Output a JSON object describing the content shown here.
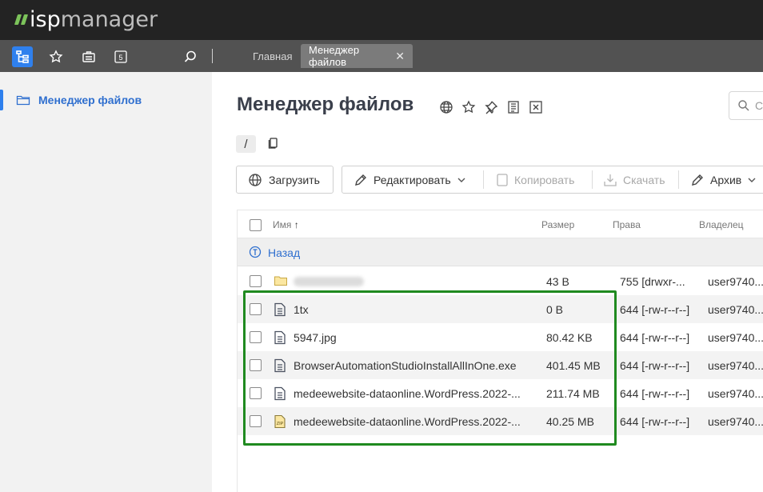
{
  "app": {
    "logo_prefix": "isp",
    "logo_suffix": "manager",
    "accent": "#2f80ed",
    "highlight_color": "#1f8a1f"
  },
  "topnav": {
    "icons": [
      "tree-icon",
      "star-icon",
      "briefcase-icon",
      "calendar-5-icon",
      "search-icon"
    ],
    "calendar_number": "5",
    "tabs": [
      {
        "label": "Главная"
      },
      {
        "label": "Менеджер файлов",
        "close": "✕"
      }
    ]
  },
  "sidebar": {
    "items": [
      {
        "label": "Менеджер файлов"
      }
    ]
  },
  "main": {
    "title": "Менеджер файлов",
    "title_icons": [
      "globe-icon",
      "star-icon",
      "pin-icon",
      "list-icon",
      "excel-icon"
    ],
    "search": {
      "placeholder": "Сь"
    },
    "path": "/",
    "toolbar": {
      "upload": "Загрузить",
      "edit": "Редактировать",
      "copy": "Копировать",
      "download": "Скачать",
      "archive": "Архив"
    }
  },
  "table": {
    "columns": [
      "Имя",
      "Размер",
      "Права",
      "Владелец"
    ],
    "sort_indicator": "↑",
    "back_label": "Назад",
    "rows": [
      {
        "name": "",
        "size": "43 B",
        "perm": "755 [drwxr-...",
        "owner": "user9740...",
        "type": "folder"
      },
      {
        "name": "1tx",
        "size": "0 B",
        "perm": "644 [-rw-r--r--]",
        "owner": "user9740...",
        "type": "file"
      },
      {
        "name": "5947.jpg",
        "size": "80.42 KB",
        "perm": "644 [-rw-r--r--]",
        "owner": "user9740...",
        "type": "file"
      },
      {
        "name": "BrowserAutomationStudioInstallAllInOne.exe",
        "size": "401.45 MB",
        "perm": "644 [-rw-r--r--]",
        "owner": "user9740...",
        "type": "file"
      },
      {
        "name": "medeewebsite-dataonline.WordPress.2022-...",
        "size": "211.74 MB",
        "perm": "644 [-rw-r--r--]",
        "owner": "user9740...",
        "type": "file"
      },
      {
        "name": "medeewebsite-dataonline.WordPress.2022-...",
        "size": "40.25 MB",
        "perm": "644 [-rw-r--r--]",
        "owner": "user9740...",
        "type": "zip"
      }
    ]
  }
}
